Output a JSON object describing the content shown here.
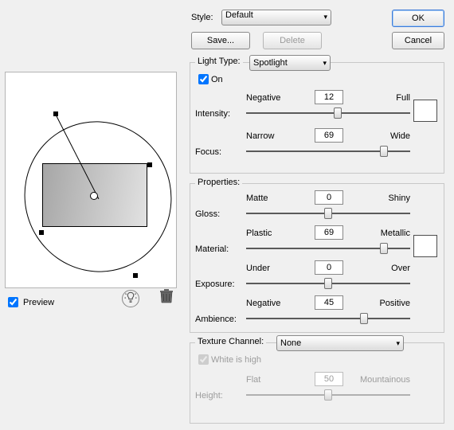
{
  "top": {
    "style_label": "Style:",
    "style_value": "Default",
    "save": "Save...",
    "delete": "Delete",
    "ok": "OK",
    "cancel": "Cancel"
  },
  "light": {
    "group": "Light Type:",
    "type_value": "Spotlight",
    "on_label": "On",
    "on_checked": true,
    "intensity_label": "Intensity:",
    "intensity_left": "Negative",
    "intensity_right": "Full",
    "intensity_value": "12",
    "focus_label": "Focus:",
    "focus_left": "Narrow",
    "focus_right": "Wide",
    "focus_value": "69"
  },
  "props": {
    "group": "Properties:",
    "gloss_label": "Gloss:",
    "gloss_left": "Matte",
    "gloss_right": "Shiny",
    "gloss_value": "0",
    "material_label": "Material:",
    "material_left": "Plastic",
    "material_right": "Metallic",
    "material_value": "69",
    "exposure_label": "Exposure:",
    "exposure_left": "Under",
    "exposure_right": "Over",
    "exposure_value": "0",
    "ambience_label": "Ambience:",
    "ambience_left": "Negative",
    "ambience_right": "Positive",
    "ambience_value": "45"
  },
  "tex": {
    "group": "Texture Channel:",
    "channel_value": "None",
    "white_label": "White is high",
    "white_checked": true,
    "height_label": "Height:",
    "height_left": "Flat",
    "height_right": "Mountainous",
    "height_value": "50"
  },
  "preview": {
    "label": "Preview",
    "checked": true
  }
}
